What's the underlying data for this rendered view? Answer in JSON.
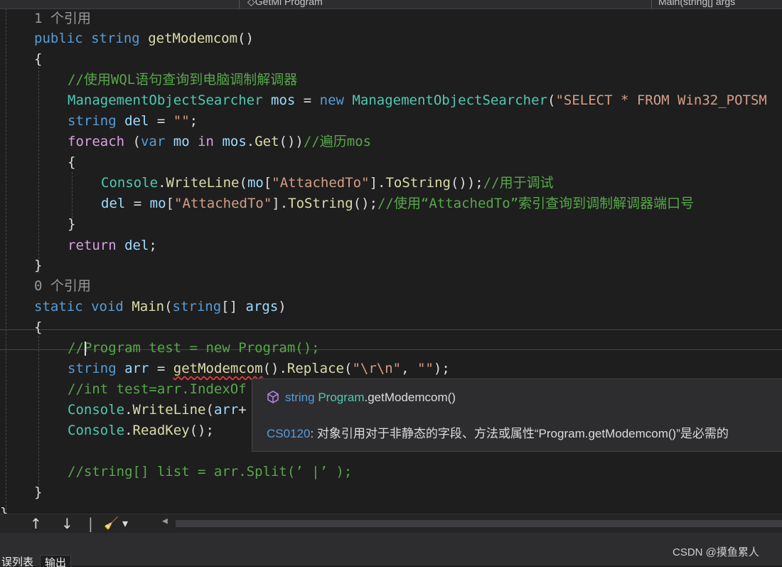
{
  "navbar": {
    "type_segment": "Program",
    "member_segment_prefix": "GetMi",
    "member_segment": "◇GetMi Program",
    "method_segment": "Main(string[] args"
  },
  "code": {
    "ref1": "1 个引用",
    "l_sig1": {
      "kw": "public",
      "type": "string",
      "name": "getModemcom",
      "tail": "()"
    },
    "brace_open": "{",
    "comment1": "//使用WQL语句查询到电脑调制解调器",
    "l_search": {
      "cls1": "ManagementObjectSearcher",
      "var": "mos",
      "eq": " = ",
      "kw": "new",
      "cls2": "ManagementObjectSearcher",
      "paren": "(",
      "str": "\"SELECT * FROM Win32_POTSM"
    },
    "l_del": {
      "kw": "string",
      "var": "del",
      "eq": " = ",
      "str": "\"\"",
      "semi": ";"
    },
    "l_foreach": {
      "ctl": "foreach",
      "p1": " (",
      "kw1": "var",
      "var1": "mo",
      "kw2": "in",
      "var2": "mos",
      "fn": "Get",
      "tail": "())",
      "cmt": "//遍历mos"
    },
    "l_console1": {
      "cls": "Console",
      "fn": "WriteLine",
      "p": "(",
      "var": "mo",
      "b1": "[",
      "str": "\"AttachedTo\"",
      "b2": "].",
      "fn2": "ToString",
      "tail": "());",
      "cmt": "//用于调试"
    },
    "l_assign": {
      "var1": "del",
      "eq": " = ",
      "var2": "mo",
      "b1": "[",
      "str": "\"AttachedTo\"",
      "b2": "].",
      "fn": "ToString",
      "tail": "();",
      "cmt": "//使用“AttachedTo”索引查询到调制解调器端口号"
    },
    "brace_close": "}",
    "l_return": {
      "ctl": "return",
      "var": "del",
      "semi": ";"
    },
    "ref0": "0 个引用",
    "l_sig2": {
      "kw1": "static",
      "kw2": "void",
      "fn": "Main",
      "p": "(",
      "kw3": "string",
      "br": "[] ",
      "var": "args",
      "tail": ")"
    },
    "l_cmt_program": "//Program test = new Program();",
    "l_arr": {
      "kw": "string",
      "var": "arr",
      "eq": " = ",
      "fn": "getModemcom",
      "mid": "().",
      "fn2": "Replace",
      "p": "(",
      "str1": "\"\\r\\n\"",
      "comma": ", ",
      "str2": "\"\"",
      "tail": ");"
    },
    "l_cmt_int": "//int test=arr.IndexOf",
    "l_console2": {
      "cls": "Console",
      "fn": "WriteLine",
      "p": "(",
      "var": "arr",
      "tail": "+"
    },
    "l_console3": {
      "cls": "Console",
      "fn": "ReadKey",
      "tail": "();"
    },
    "l_cmt_split": "//string[] list = arr.Split(’ |’ );"
  },
  "tooltip": {
    "sig_kw": "string",
    "sig_cls": "Program",
    "sig_rest": ".getModemcom()",
    "err_code": "CS0120",
    "err_msg": ": 对象引用对于非静态的字段、方法或属性“Program.getModemcom()”是必需的",
    "icon": "method-cube-icon"
  },
  "toolbar": {
    "up_icon": "↑",
    "down_icon": "↓",
    "separator": "|",
    "brush_icon": "🧹",
    "dropdown_icon": "▾",
    "scroll_left_icon": "◀"
  },
  "bottom": {
    "tab1": "误列表",
    "tab2": "输出",
    "watermark": "CSDN @摸鱼累人"
  },
  "colors": {
    "background": "#1e1e1e",
    "keyword": "#569cd6",
    "class": "#4ec9b0",
    "method": "#dcdcaa",
    "variable": "#9cdcfe",
    "string": "#d69d85",
    "comment": "#57a64a",
    "control": "#d8a0df",
    "error_squiggle": "#e03c3c"
  }
}
